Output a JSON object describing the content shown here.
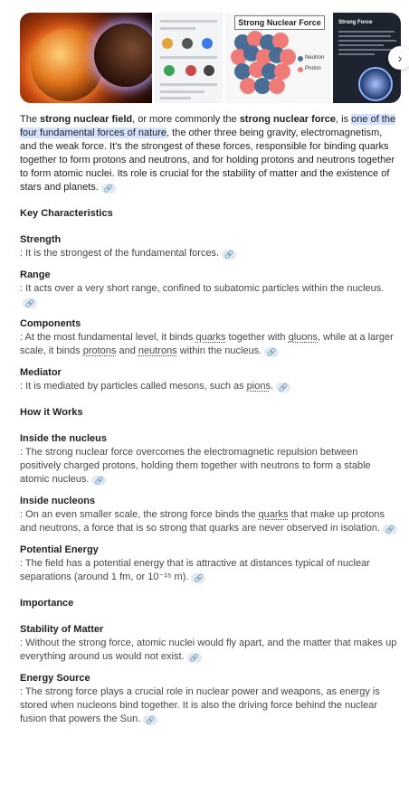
{
  "thumbnails": {
    "t3_title": "Strong Nuclear Force",
    "t3_legend_neutron": "Neutron",
    "t3_legend_proton": "Proton",
    "t4_title": "Strong Force"
  },
  "colors": {
    "highlight": "#d3e3fd",
    "neutron": "#4a6d95",
    "proton": "#ef7b78",
    "link_chip": "#e3e8f1"
  },
  "intro": {
    "p1": "The ",
    "b1": "strong nuclear field",
    "p2": ", or more commonly the ",
    "b2": "strong nuclear force",
    "p3": ", is ",
    "hl": "one of the four fundamental forces of nature",
    "p4": ", the other three being gravity, electromagnetism, and the weak force. It's the strongest of these forces, responsible for binding quarks together to form protons and neutrons, and for holding protons and neutrons together to form atomic nuclei. Its role is crucial for the stability of matter and the existence of stars and planets."
  },
  "sections": {
    "key": "Key Characteristics",
    "how": "How it Works",
    "imp": "Importance"
  },
  "items": {
    "strength_t": "Strength",
    "strength_d": ": It is the strongest of the fundamental forces.",
    "range_t": "Range",
    "range_d": ": It acts over a very short range, confined to subatomic particles within the nucleus.",
    "comp_t": "Components",
    "comp_d1": ": At the most fundamental level, it binds ",
    "comp_u1": "quarks",
    "comp_d2": " together with ",
    "comp_u2": "gluons",
    "comp_d3": ", while at a larger scale, it binds ",
    "comp_u3": "protons",
    "comp_d4": " and ",
    "comp_u4": "neutrons",
    "comp_d5": " within the nucleus.",
    "med_t": "Mediator",
    "med_d1": ": It is mediated by particles called mesons, such as ",
    "med_u1": "pions",
    "med_d2": ".",
    "in_nuc_t": "Inside the nucleus",
    "in_nuc_d": ": The strong nuclear force overcomes the electromagnetic repulsion between positively charged protons, holding them together with neutrons to form a stable atomic nucleus.",
    "in_n_t": "Inside nucleons",
    "in_n_d1": ": On an even smaller scale, the strong force binds the ",
    "in_n_u1": "quarks",
    "in_n_d2": " that make up protons and neutrons, a force that is so strong that quarks are never observed in isolation.",
    "pe_t": "Potential Energy",
    "pe_d": ": The field has a potential energy that is attractive at distances typical of nuclear separations (around 1 fm, or 10⁻¹⁵ m).",
    "stab_t": "Stability of Matter",
    "stab_d": ": Without the strong force, atomic nuclei would fly apart, and the matter that makes up everything around us would not exist.",
    "en_t": "Energy Source",
    "en_d": ": The strong force plays a crucial role in nuclear power and weapons, as energy is stored when nucleons bind together. It is also the driving force behind the nuclear fusion that powers the Sun."
  }
}
